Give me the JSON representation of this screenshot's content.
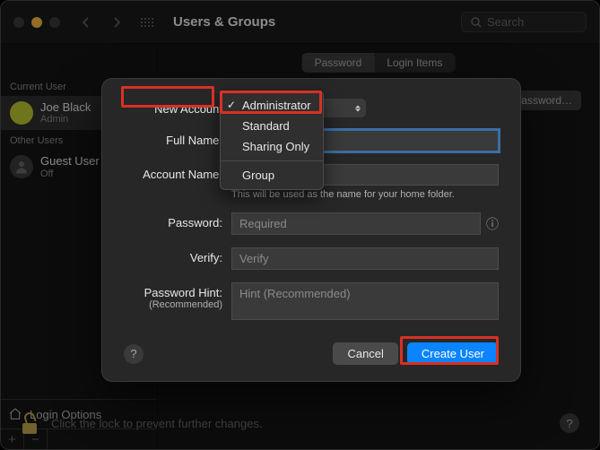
{
  "window": {
    "title": "Users & Groups",
    "search_placeholder": "Search"
  },
  "sidebar": {
    "current_user_label": "Current User",
    "other_users_label": "Other Users",
    "current_user": {
      "name": "Joe Black",
      "role": "Admin"
    },
    "other_users": [
      {
        "name": "Guest User",
        "role": "Off"
      }
    ],
    "login_options_label": "Login Options",
    "plus": "+",
    "minus": "−"
  },
  "content": {
    "tab_password": "Password",
    "tab_login_items": "Login Items",
    "change_password": "Change Password…"
  },
  "sheet": {
    "labels": {
      "new_account": "New Account",
      "full_name": "Full Name:",
      "account_name": "Account Name:",
      "account_name_note": "This will be used as the name for your home folder.",
      "password": "Password:",
      "verify": "Verify:",
      "hint": "Password Hint:",
      "hint_sub": "(Recommended)"
    },
    "placeholders": {
      "password": "Required",
      "verify": "Verify",
      "hint": "Hint (Recommended)"
    },
    "account_type_selected": "Administrator",
    "account_type_options": {
      "administrator": "Administrator",
      "standard": "Standard",
      "sharing_only": "Sharing Only",
      "group": "Group"
    },
    "buttons": {
      "cancel": "Cancel",
      "create": "Create User"
    }
  },
  "footer": {
    "lock_text": "Click the lock to prevent further changes.",
    "help": "?"
  }
}
